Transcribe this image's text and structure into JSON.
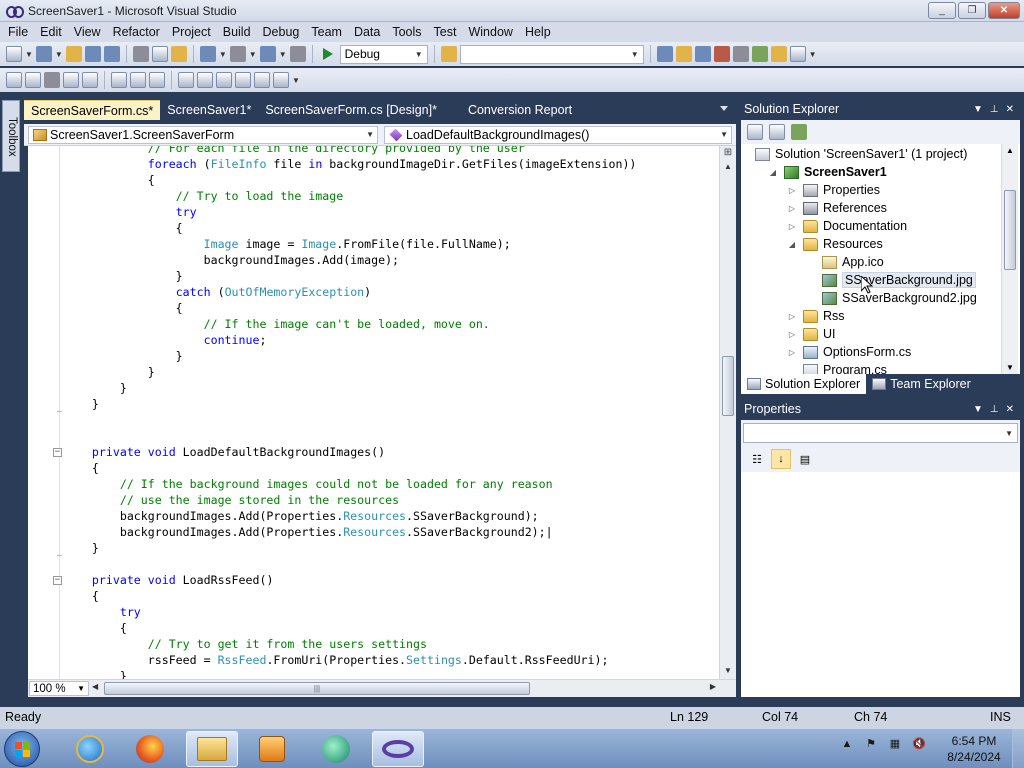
{
  "window": {
    "title": "ScreenSaver1 - Microsoft Visual Studio",
    "minimize": "_",
    "maximize": "❐",
    "close": "✕"
  },
  "menu": [
    "File",
    "Edit",
    "View",
    "Refactor",
    "Project",
    "Build",
    "Debug",
    "Team",
    "Data",
    "Tools",
    "Test",
    "Window",
    "Help"
  ],
  "toolbar": {
    "config": "Debug",
    "platform": ""
  },
  "toolbox": {
    "label": "Toolbox"
  },
  "editor": {
    "tabs": [
      "ScreenSaverForm.cs*",
      "ScreenSaver1*",
      "ScreenSaverForm.cs [Design]*",
      "Conversion Report"
    ],
    "active_tab": 0,
    "nav_left": "ScreenSaver1.ScreenSaverForm",
    "nav_right": "LoadDefaultBackgroundImages()",
    "zoom": "100 %",
    "code": [
      [
        [
          "cm",
          "            // For each file in the directory provided by the user"
        ]
      ],
      [
        [
          "",
          "            "
        ],
        [
          "kw",
          "foreach"
        ],
        [
          "",
          " ("
        ],
        [
          "ty",
          "FileInfo"
        ],
        [
          "",
          " file "
        ],
        [
          "kw",
          "in"
        ],
        [
          "",
          " backgroundImageDir.GetFiles(imageExtension))"
        ]
      ],
      [
        [
          "",
          "            {"
        ]
      ],
      [
        [
          "",
          "                "
        ],
        [
          "cm",
          "// Try to load the image"
        ]
      ],
      [
        [
          "",
          "                "
        ],
        [
          "kw",
          "try"
        ]
      ],
      [
        [
          "",
          "                {"
        ]
      ],
      [
        [
          "",
          "                    "
        ],
        [
          "ty",
          "Image"
        ],
        [
          "",
          " image = "
        ],
        [
          "ty",
          "Image"
        ],
        [
          "",
          ".FromFile(file.FullName);"
        ]
      ],
      [
        [
          "",
          "                    backgroundImages.Add(image);"
        ]
      ],
      [
        [
          "",
          "                }"
        ]
      ],
      [
        [
          "",
          "                "
        ],
        [
          "kw",
          "catch"
        ],
        [
          "",
          " ("
        ],
        [
          "ty",
          "OutOfMemoryException"
        ],
        [
          "",
          ")"
        ]
      ],
      [
        [
          "",
          "                {"
        ]
      ],
      [
        [
          "",
          "                    "
        ],
        [
          "cm",
          "// If the image can't be loaded, move on."
        ]
      ],
      [
        [
          "",
          "                    "
        ],
        [
          "kw",
          "continue"
        ],
        [
          "",
          ";"
        ]
      ],
      [
        [
          "",
          "                }"
        ]
      ],
      [
        [
          "",
          "            }"
        ]
      ],
      [
        [
          "",
          "        }"
        ]
      ],
      [
        [
          "",
          "    }"
        ]
      ],
      [
        [
          "",
          ""
        ]
      ],
      [
        [
          "",
          ""
        ]
      ],
      [
        [
          "",
          "    "
        ],
        [
          "kw",
          "private"
        ],
        [
          "",
          " "
        ],
        [
          "kw",
          "void"
        ],
        [
          "",
          " LoadDefaultBackgroundImages()"
        ]
      ],
      [
        [
          "",
          "    {"
        ]
      ],
      [
        [
          "",
          "        "
        ],
        [
          "cm",
          "// If the background images could not be loaded for any reason"
        ]
      ],
      [
        [
          "",
          "        "
        ],
        [
          "cm",
          "// use the image stored in the resources"
        ]
      ],
      [
        [
          "",
          "        backgroundImages.Add(Properties."
        ],
        [
          "ty",
          "Resources"
        ],
        [
          "",
          ".SSaverBackground);"
        ]
      ],
      [
        [
          "",
          "        backgroundImages.Add(Properties."
        ],
        [
          "ty",
          "Resources"
        ],
        [
          "",
          ".SSaverBackground2);|"
        ]
      ],
      [
        [
          "",
          "    }"
        ]
      ],
      [
        [
          "",
          ""
        ]
      ],
      [
        [
          "",
          "    "
        ],
        [
          "kw",
          "private"
        ],
        [
          "",
          " "
        ],
        [
          "kw",
          "void"
        ],
        [
          "",
          " LoadRssFeed()"
        ]
      ],
      [
        [
          "",
          "    {"
        ]
      ],
      [
        [
          "",
          "        "
        ],
        [
          "kw",
          "try"
        ]
      ],
      [
        [
          "",
          "        {"
        ]
      ],
      [
        [
          "",
          "            "
        ],
        [
          "cm",
          "// Try to get it from the users settings"
        ]
      ],
      [
        [
          "",
          "            rssFeed = "
        ],
        [
          "ty",
          "RssFeed"
        ],
        [
          "",
          ".FromUri(Properties."
        ],
        [
          "ty",
          "Settings"
        ],
        [
          "",
          ".Default.RssFeedUri);"
        ]
      ],
      [
        [
          "",
          "        }"
        ]
      ]
    ]
  },
  "solution_explorer": {
    "title": "Solution Explorer",
    "items": [
      {
        "label": "Solution 'ScreenSaver1' (1 project)",
        "icon": "solution-icon",
        "level": 0,
        "expander": ""
      },
      {
        "label": "ScreenSaver1",
        "icon": "project-icon",
        "level": 1,
        "expander": "◢",
        "bold": true
      },
      {
        "label": "Properties",
        "icon": "properties-icon",
        "level": 2,
        "expander": "▷"
      },
      {
        "label": "References",
        "icon": "references-icon",
        "level": 2,
        "expander": "▷"
      },
      {
        "label": "Documentation",
        "icon": "folder-icon",
        "level": 2,
        "expander": "▷"
      },
      {
        "label": "Resources",
        "icon": "folder-icon",
        "level": 2,
        "expander": "◢"
      },
      {
        "label": "App.ico",
        "icon": "ico-file-icon",
        "level": 3,
        "expander": ""
      },
      {
        "label": "SSaverBackground.jpg",
        "icon": "image-file-icon",
        "level": 3,
        "expander": "",
        "selected": true
      },
      {
        "label": "SSaverBackground2.jpg",
        "icon": "image-file-icon",
        "level": 3,
        "expander": ""
      },
      {
        "label": "Rss",
        "icon": "folder-icon",
        "level": 2,
        "expander": "▷"
      },
      {
        "label": "UI",
        "icon": "folder-icon",
        "level": 2,
        "expander": "▷"
      },
      {
        "label": "OptionsForm.cs",
        "icon": "form-file-icon",
        "level": 2,
        "expander": "▷"
      },
      {
        "label": "Program.cs",
        "icon": "cs-file-icon",
        "level": 2,
        "expander": ""
      }
    ],
    "tabs": [
      "Solution Explorer",
      "Team Explorer"
    ]
  },
  "properties": {
    "title": "Properties",
    "object": ""
  },
  "status": {
    "text": "Ready",
    "ln": "Ln 129",
    "col": "Col 74",
    "ch": "Ch 74",
    "mode": "INS"
  },
  "taskbar": {
    "time": "6:54 PM",
    "date": "8/24/2024",
    "apps": [
      "internet-explorer-icon",
      "firefox-icon",
      "file-explorer-icon",
      "media-player-icon",
      "app-icon",
      "visual-studio-icon"
    ]
  }
}
